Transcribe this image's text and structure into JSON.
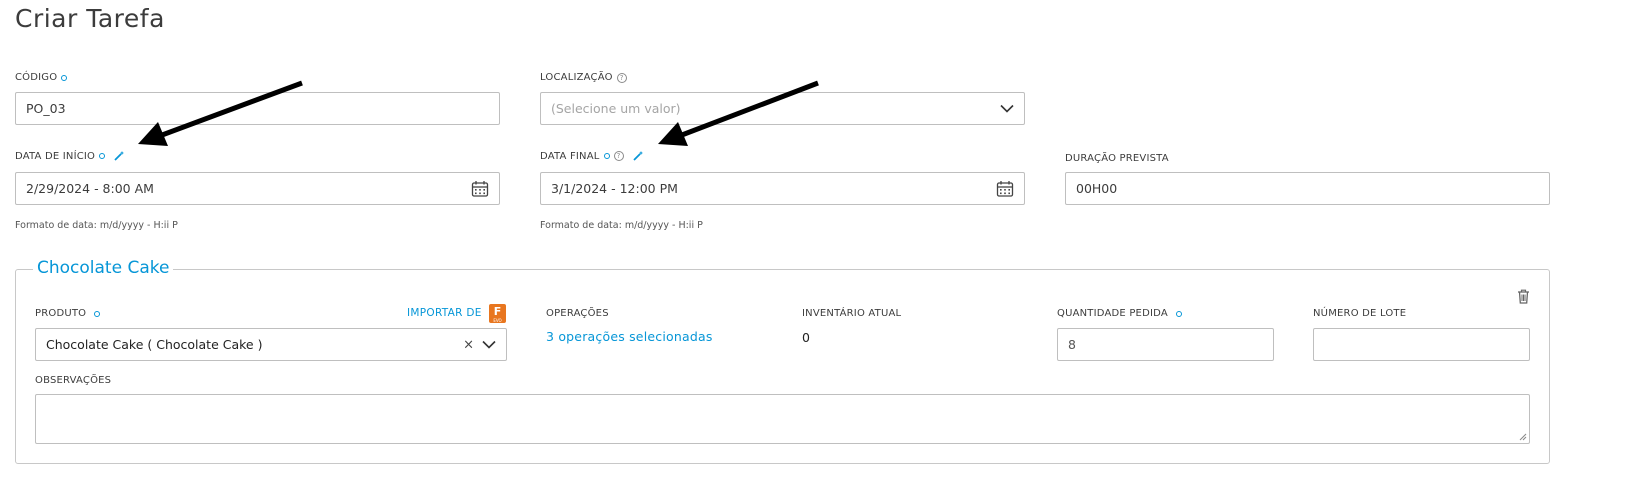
{
  "page": {
    "title": "Criar Tarefa"
  },
  "form": {
    "codigo": {
      "label": "CÓDIGO",
      "value": "PO_03"
    },
    "localizacao": {
      "label": "LOCALIZAÇÃO",
      "placeholder": "(Selecione um valor)"
    },
    "data_inicio": {
      "label": "DATA DE INÍCIO",
      "value": "2/29/2024 - 8:00 AM",
      "hint": "Formato de data: m/d/yyyy - H:ii P"
    },
    "data_final": {
      "label": "DATA FINAL",
      "value": "3/1/2024 - 12:00 PM",
      "hint": "Formato de data: m/d/yyyy - H:ii P"
    },
    "duracao": {
      "label": "DURAÇÃO PREVISTA",
      "value": "00H00"
    }
  },
  "section": {
    "title": "Chocolate Cake",
    "produto": {
      "label": "PRODUTO",
      "value": "Chocolate Cake ( Chocolate Cake )",
      "import_label": "IMPORTAR DE",
      "import_icon_letter": "F",
      "import_icon_sub": "EVO"
    },
    "operacoes": {
      "label": "OPERAÇÕES",
      "link": "3 operações selecionadas"
    },
    "inventario": {
      "label": "INVENTÁRIO ATUAL",
      "value": "0"
    },
    "quantidade": {
      "label": "QUANTIDADE PEDIDA",
      "value": "8"
    },
    "lote": {
      "label": "NÚMERO DE LOTE",
      "value": ""
    },
    "observacoes": {
      "label": "OBSERVAÇÕES",
      "value": ""
    }
  },
  "colors": {
    "accent": "#0696d7",
    "border": "#bfbfbf",
    "fusion": "#e8761f"
  },
  "icons": [
    "required-dot-icon",
    "help-icon",
    "magic-wand-icon",
    "chevron-down-icon",
    "calendar-icon",
    "clear-icon",
    "trash-icon",
    "fusion-icon"
  ]
}
